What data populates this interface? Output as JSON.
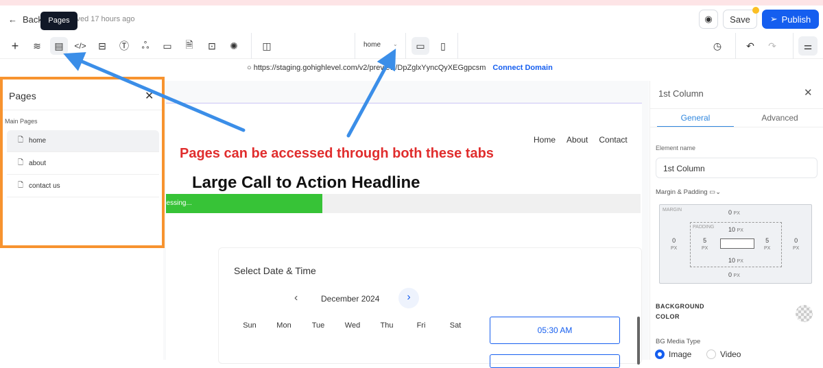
{
  "header": {
    "back": "Back",
    "saved": "Last saved 17 hours ago",
    "save": "Save",
    "publish": "Publish",
    "tooltip": "Pages"
  },
  "toolbar": {
    "page_select": "home",
    "icons": [
      "plus-icon",
      "layers-icon",
      "pages-icon",
      "code-icon",
      "paint-icon",
      "text-icon",
      "circles-icon",
      "layout-icon",
      "seo-icon",
      "terminal-icon",
      "cookie-icon",
      "columns-icon"
    ]
  },
  "url": {
    "text": "https://staging.gohighlevel.com/v2/preview/DpZglxYyncQyXEGgpcsm",
    "connect": "Connect Domain"
  },
  "pages_panel": {
    "title": "Pages",
    "section": "Main Pages",
    "items": [
      "home",
      "about",
      "contact us"
    ]
  },
  "canvas": {
    "nav": [
      "Home",
      "About",
      "Contact"
    ],
    "annotation": "Pages can be accessed through both these tabs",
    "headline": "Large Call to Action Headline",
    "progress_text": "Processing...",
    "progress": 0.33,
    "calendar": {
      "title": "Select Date & Time",
      "month": "December 2024",
      "days": [
        "Sun",
        "Mon",
        "Tue",
        "Wed",
        "Thu",
        "Fri",
        "Sat"
      ],
      "slot": "05:30 AM"
    }
  },
  "right_panel": {
    "title": "1st Column",
    "tabs": [
      "General",
      "Advanced"
    ],
    "element_name_label": "Element name",
    "element_name": "1st Column",
    "margin_padding": "Margin & Padding",
    "margin_label": "MARGIN",
    "padding_label": "PADDING",
    "margin": {
      "top": "0",
      "right": "0",
      "bottom": "0",
      "left": "0"
    },
    "padding": {
      "top": "10",
      "right": "5",
      "bottom": "10",
      "left": "5"
    },
    "unit": "PX",
    "bg_color": "BACKGROUND COLOR",
    "bg_media": "BG Media Type",
    "media_options": [
      "Image",
      "Video"
    ]
  },
  "colors": {
    "accent": "#155eef",
    "annotation": "#e02d2d",
    "highlight": "#f7932f",
    "arrow": "#3b8ee8",
    "progress": "#37c337"
  }
}
